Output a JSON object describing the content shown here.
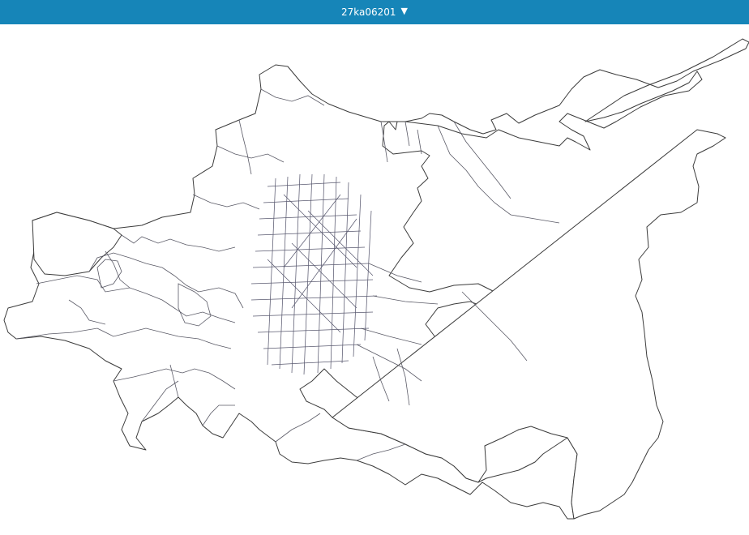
{
  "header": {
    "title": "27ka06201",
    "dropdown_icon": "caret-down-icon",
    "background_color": "#1685b8",
    "text_color": "#ffffff"
  },
  "map": {
    "boundary_color": "#3b3b3b",
    "fill_color": "#ffffff"
  }
}
